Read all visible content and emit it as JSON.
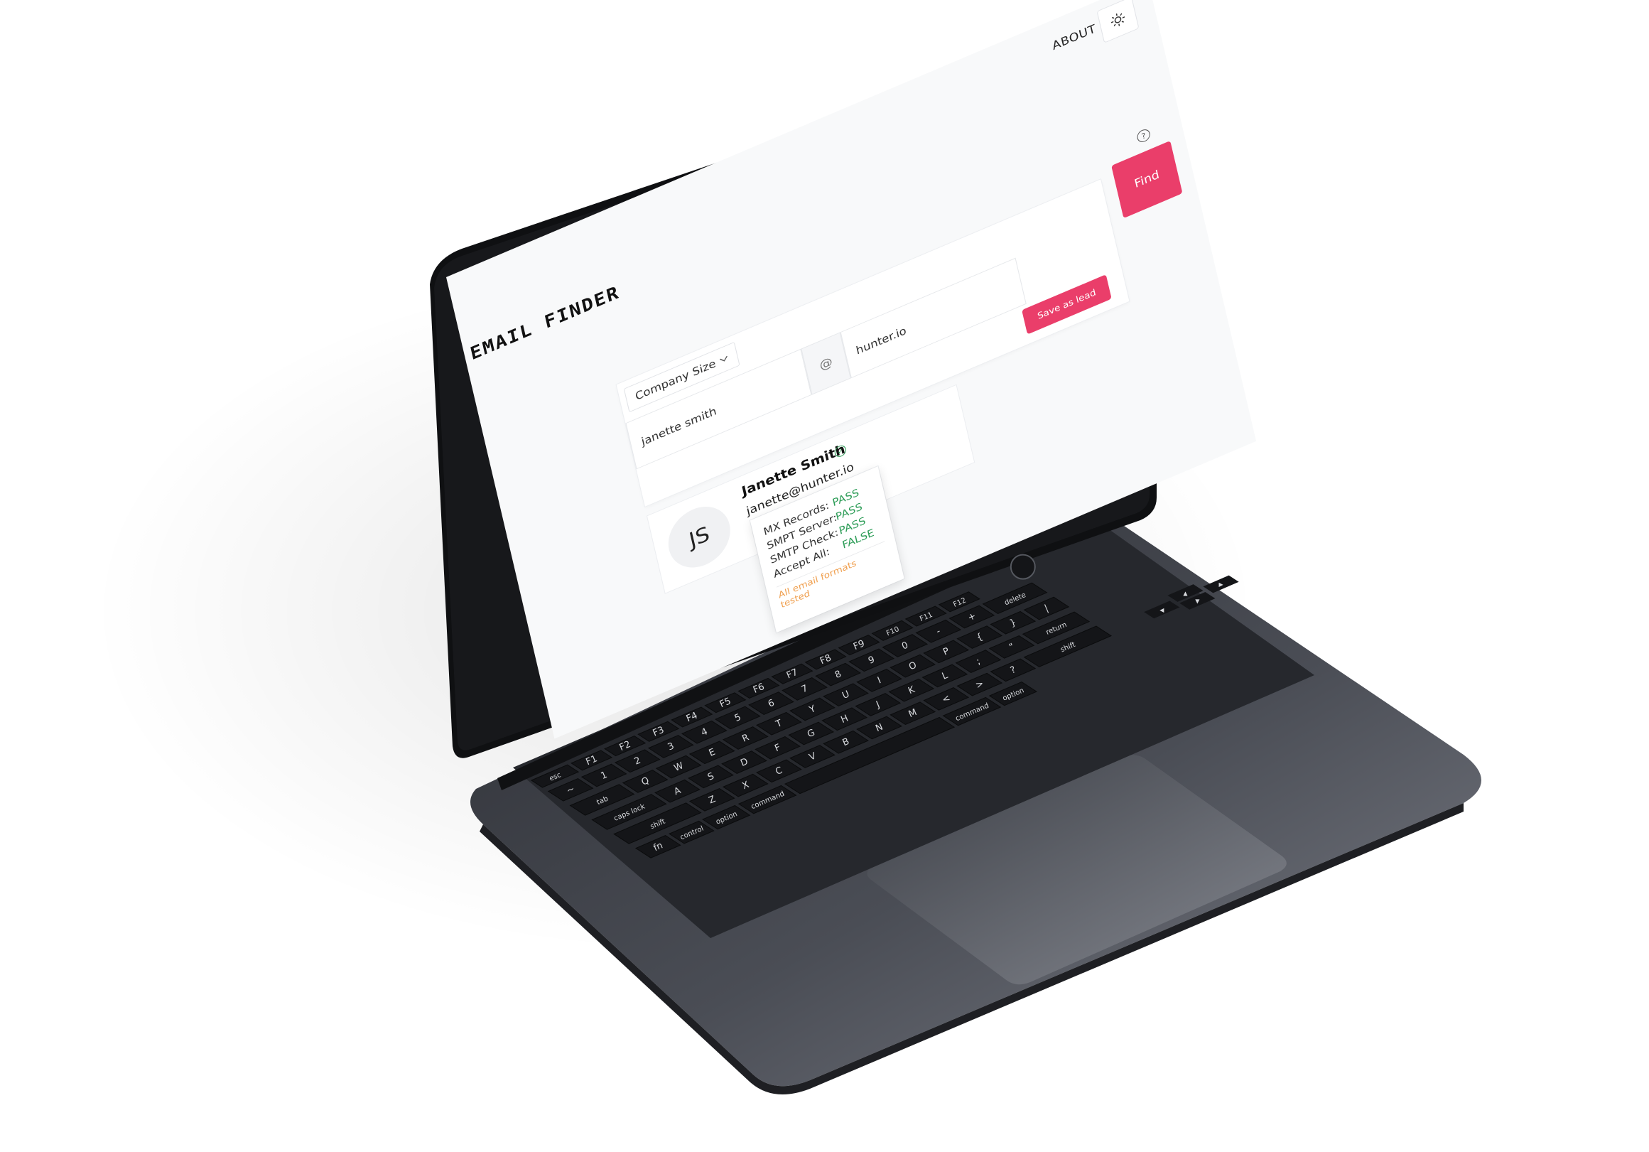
{
  "nav": {
    "about_label": "ABOUT",
    "theme_icon": "sun-icon"
  },
  "brand": {
    "title": "EMAIL FINDER"
  },
  "search": {
    "company_size_label": "Company Size",
    "name_value": "janette smith",
    "at_symbol": "@",
    "domain_value": "hunter.io",
    "find_label": "Find",
    "save_label": "Save as lead",
    "help_symbol": "?"
  },
  "result": {
    "initials": "JS",
    "full_name": "Janette Smith",
    "email": "janette@hunter.io"
  },
  "verification": {
    "checks": [
      {
        "label": "MX Records:",
        "value": "PASS"
      },
      {
        "label": "SMPT Server:",
        "value": "PASS"
      },
      {
        "label": "SMTP Check:",
        "value": "PASS"
      },
      {
        "label": "Accept All:",
        "value": "FALSE"
      }
    ],
    "note": "All email formats tested"
  },
  "colors": {
    "accent": "#ea3e6a",
    "pass": "#2e9d58",
    "note": "#f0a050",
    "laptop_body": "#3a3d44"
  },
  "keyboard": {
    "fn_row": [
      "esc",
      "F1",
      "F2",
      "F3",
      "F4",
      "F5",
      "F6",
      "F7",
      "F8",
      "F9",
      "F10",
      "F11",
      "F12"
    ],
    "row1": [
      "~",
      "1",
      "2",
      "3",
      "4",
      "5",
      "6",
      "7",
      "8",
      "9",
      "0",
      "-",
      "+",
      "delete"
    ],
    "row2": [
      "tab",
      "Q",
      "W",
      "E",
      "R",
      "T",
      "Y",
      "U",
      "I",
      "O",
      "P",
      "{",
      "}",
      "|"
    ],
    "row3": [
      "caps lock",
      "A",
      "S",
      "D",
      "F",
      "G",
      "H",
      "J",
      "K",
      "L",
      ";",
      "\"",
      "return"
    ],
    "row4": [
      "shift",
      "Z",
      "X",
      "C",
      "V",
      "B",
      "N",
      "M",
      "<",
      ">",
      "?",
      "shift"
    ],
    "row5": [
      "fn",
      "control",
      "option",
      "command",
      "command",
      "option"
    ]
  }
}
